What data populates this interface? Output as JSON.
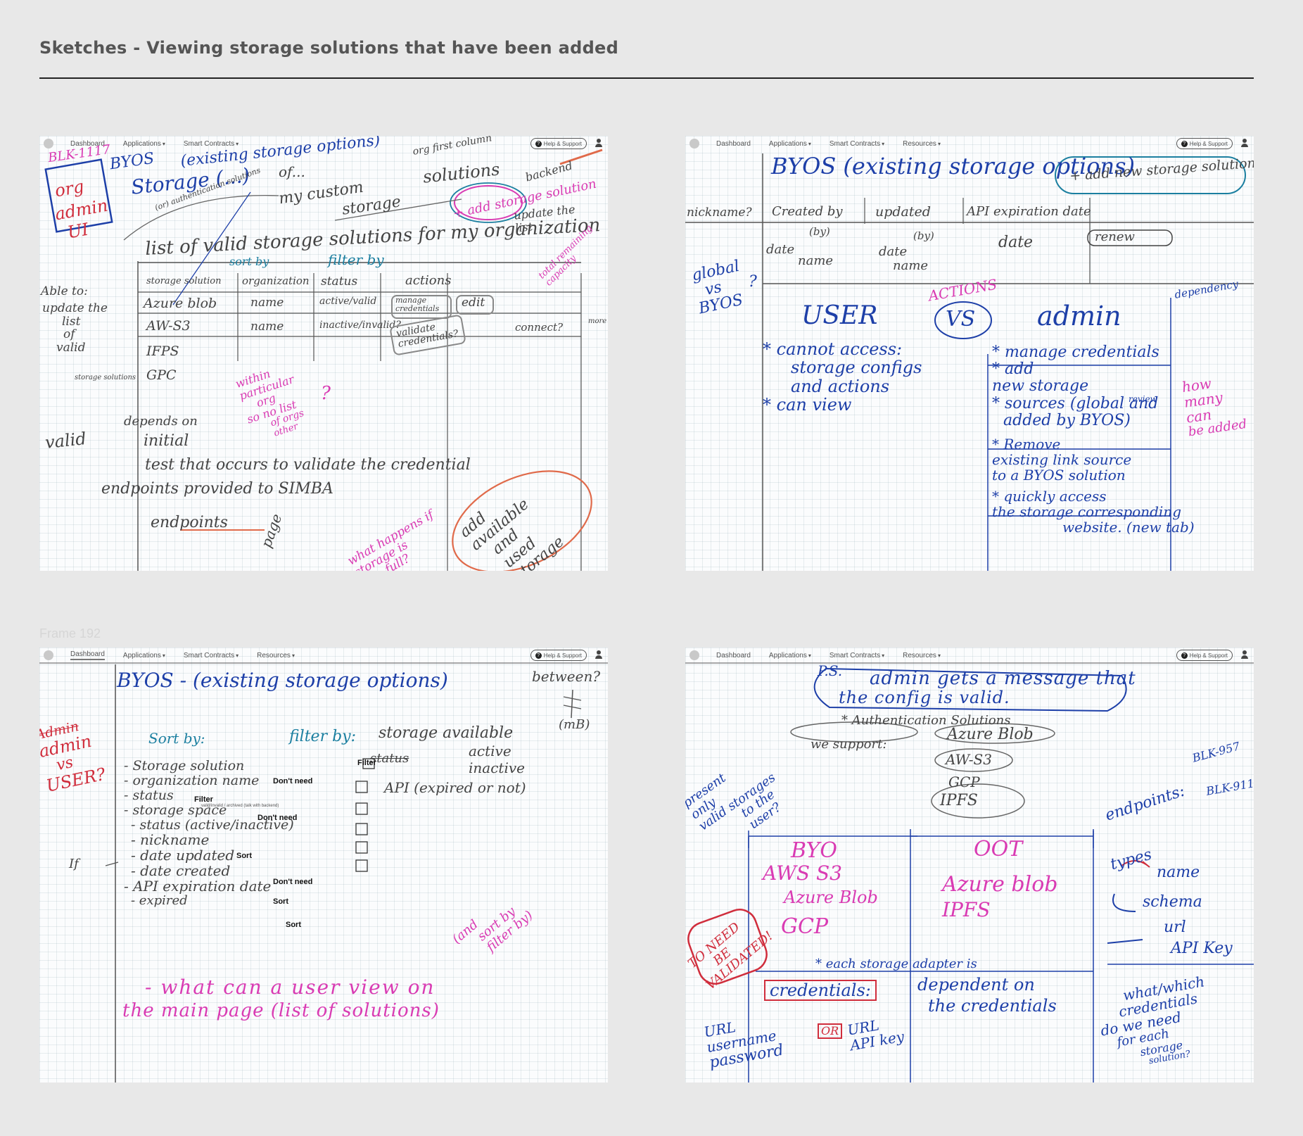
{
  "page": {
    "title_bold": "Sketches",
    "title_rest": " - Viewing storage solutions that have been added",
    "frame_label": "Frame 192"
  },
  "nav": {
    "items": [
      "Dashboard",
      "Applications",
      "Smart Contracts",
      "Resources"
    ],
    "help": "Help & Support"
  },
  "sketch1": {
    "corner": "BLK-1117",
    "org_admin": [
      "org",
      "admin",
      "UI"
    ],
    "byos_title": "BYOS",
    "storage_word": "Storage (...)",
    "existing": "(existing storage options)",
    "org_first_col": "org first column",
    "of": "of...",
    "auth_solutions": "(or) authentication solutions",
    "my_custom": "my custom",
    "storage": "storage",
    "solutions": "solutions",
    "backend": "backend",
    "add_storage": "+ add storage solution",
    "update_list": "update the list",
    "list_of_valid": "list of valid storage solutions for my organization",
    "sort_by": "sort by",
    "filter_by": "filter by",
    "total_remaining": "total remaining capacity",
    "headers": [
      "storage solution",
      "organization",
      "status",
      "actions"
    ],
    "rows": [
      {
        "name": "Azure blob",
        "org": "name",
        "status": "active/valid"
      },
      {
        "name": "AW-S3",
        "org": "name",
        "status": "inactive/invalid?"
      },
      {
        "name": "IFPS",
        "org": "",
        "status": ""
      },
      {
        "name": "GPC",
        "org": "",
        "status": ""
      }
    ],
    "manage_credentials": "manage credentials",
    "edit": "edit",
    "validate_credentials": "validate credentials?",
    "connect": "connect?",
    "more": "more",
    "able_to": "Able to:",
    "update_list_side": [
      "update the",
      "list",
      "of",
      "valid"
    ],
    "storage_solutions_small": "storage solutions",
    "within_org": [
      "within",
      "particular",
      "org",
      "so no list",
      "of orgs",
      "other"
    ],
    "qmark": "?",
    "valid": "valid",
    "depends_on": "depends on",
    "initial": "initial",
    "test_line": "test that occurs to validate the credential",
    "endpoints_line": "endpoints provided to SIMBA",
    "endpoints": "endpoints",
    "page": "page",
    "add_available": [
      "add",
      "available",
      "and",
      "used",
      "storage"
    ],
    "what_happens": [
      "what happens if",
      "storage is",
      "full?"
    ]
  },
  "sketch2": {
    "title": "BYOS (existing storage options)",
    "add_new": "+ add new storage solution",
    "headers": [
      "nickname?",
      "Created by",
      "updated",
      "API expiration date"
    ],
    "by": "(by)",
    "date_name": [
      "date",
      "name"
    ],
    "date": "date",
    "renew": "renew",
    "global_vs": [
      "global",
      "vs",
      "BYOS"
    ],
    "qmark": "?",
    "user": "USER",
    "actions": "ACTIONS",
    "vs": "VS",
    "admin": "admin",
    "dependency": "dependency",
    "cannot_access": [
      "* cannot access:",
      "storage configs",
      "and actions",
      "* can view"
    ],
    "admin_list": [
      "* manage credentials",
      "* add",
      "new storage",
      "* sources (global and",
      "added by BYOS)",
      "* Remove",
      "existing link source",
      "to a BYOS solution",
      "* quickly access",
      "the storage corresponding",
      "website. (new tab)"
    ],
    "review": "review",
    "storage_small": "storage",
    "how_many": [
      "how",
      "many",
      "can",
      "be added"
    ]
  },
  "sketch3": {
    "title": "BYOS - (existing storage options)",
    "between": "between?",
    "mb": "(mB)",
    "admin_vs_user": [
      "Admin",
      "admin",
      "vs",
      "USER?"
    ],
    "sort_by": "Sort by:",
    "filter_by": "filter by:",
    "sort_items": [
      "- Storage solution",
      "- organization name",
      "- status",
      "- storage space",
      "- status (active/inactive)",
      "- nickname",
      "- date updated",
      "- date created",
      "- API expiration date",
      "- expired"
    ],
    "notes": [
      "Don't need",
      "Filter",
      "Don't need",
      "Sort",
      "Don't need",
      "Sort",
      "Sort"
    ],
    "status_tiny": "valid/invalid / archived (talk with backend)",
    "filter_items": [
      "storage available",
      "status",
      "active",
      "inactive",
      "API (expired or not)"
    ],
    "filter_label": "Filter",
    "if": "If",
    "sort_by_filter": [
      "(and",
      "sort by",
      "filter by)"
    ],
    "what_can": "- what can a user view on",
    "main_page": "the main page (list of solutions)"
  },
  "sketch4": {
    "ps": "P.S.",
    "message": [
      "admin gets a message that",
      "the config is valid."
    ],
    "auth_solutions": "* Authentication Solutions",
    "we_support": "we support:",
    "supported": [
      "Azure Blob",
      "AW-S3",
      "GCP",
      "IPFS"
    ],
    "present_only": [
      "present",
      "only",
      "valid storages",
      "to the",
      "user?"
    ],
    "ticket1": "BLK-957",
    "endpoints": "endpoints:",
    "ticket2": "BLK-911",
    "byo": "BYO",
    "oot": "OOT",
    "byo_items": [
      "AWS S3",
      "Azure Blob",
      "GCP"
    ],
    "oot_items": [
      "Azure blob",
      "IPFS"
    ],
    "types": "types",
    "type_items": [
      "name",
      "schema",
      "url",
      "API Key"
    ],
    "need_validated": [
      "TO NEED",
      "BE",
      "VALIDATED!"
    ],
    "each_storage": "* each storage adapter is",
    "credentials": "credentials:",
    "dependent": [
      "dependent on",
      "the credentials"
    ],
    "cred_list1": [
      "URL",
      "username",
      "password"
    ],
    "or": "OR",
    "cred_list2": [
      "URL",
      "API key"
    ],
    "what_which": [
      "what/which",
      "credentials",
      "do we need",
      "for each",
      "storage",
      "solution?"
    ]
  }
}
